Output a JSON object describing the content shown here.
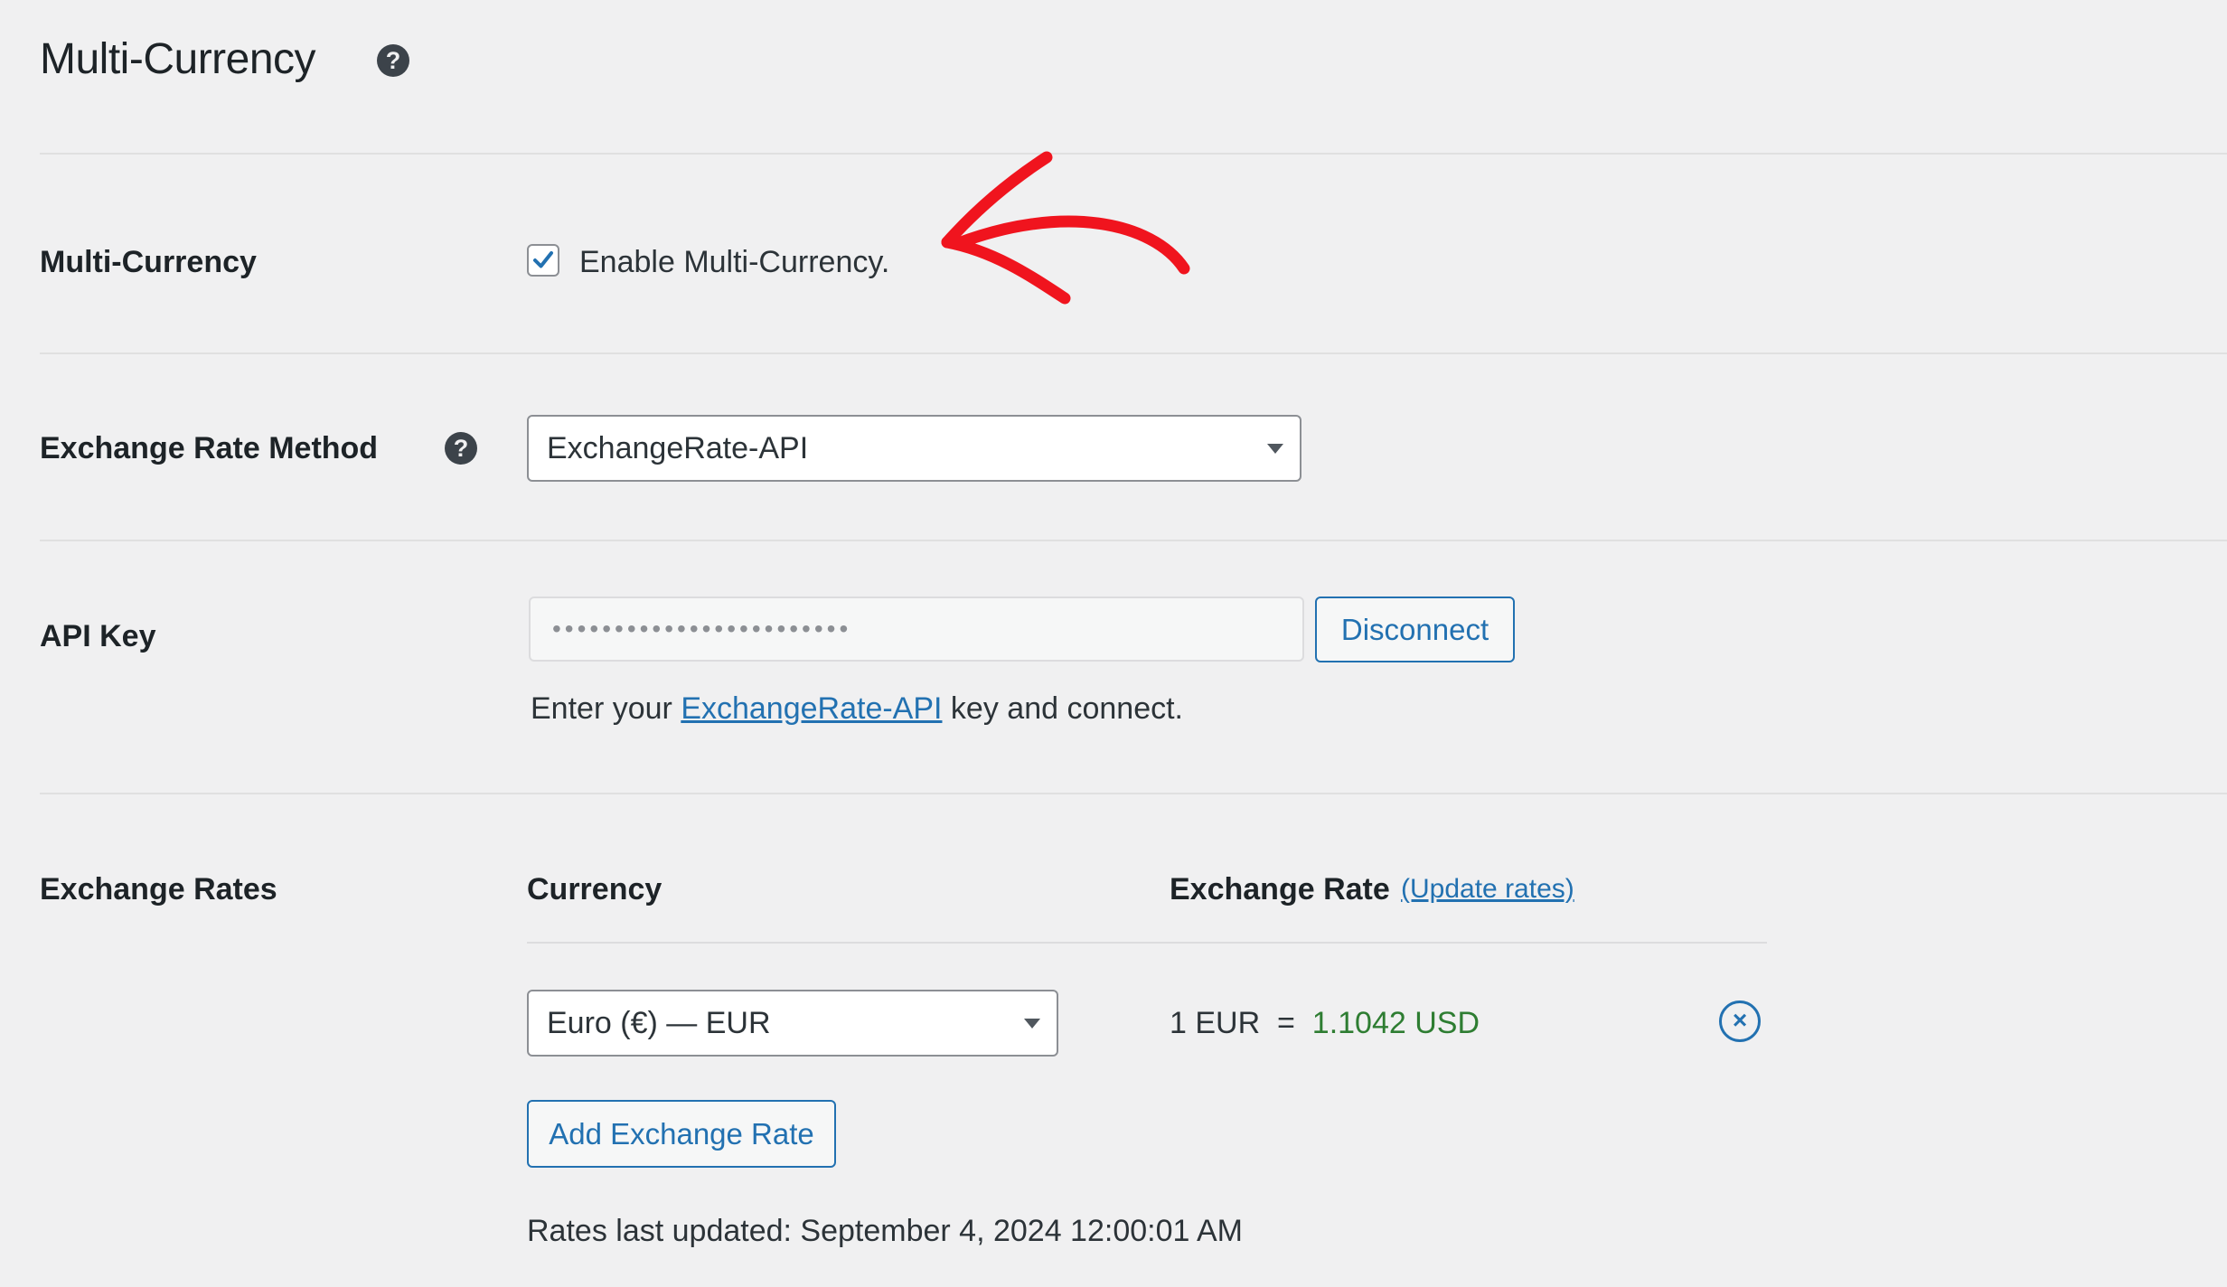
{
  "page": {
    "title": "Multi-Currency"
  },
  "multi_currency": {
    "label": "Multi-Currency",
    "checkbox_label": "Enable Multi-Currency.",
    "checked": true
  },
  "exchange_rate_method": {
    "label": "Exchange Rate Method",
    "selected": "ExchangeRate-API"
  },
  "api_key": {
    "label": "API Key",
    "masked_value": "••••••••••••••••••••••••",
    "disconnect_label": "Disconnect",
    "help_prefix": "Enter your ",
    "help_link": "ExchangeRate-API",
    "help_suffix": " key and connect."
  },
  "exchange_rates": {
    "label": "Exchange Rates",
    "col_currency": "Currency",
    "col_rate": "Exchange Rate",
    "update_link": "(Update rates)",
    "rows": [
      {
        "currency": "Euro (€) — EUR",
        "rate_prefix": "1 EUR  =  ",
        "rate_value": "1.1042",
        "rate_unit": "USD"
      }
    ],
    "add_button": "Add Exchange Rate",
    "last_updated": "Rates last updated: September 4, 2024 12:00:01 AM"
  },
  "icons": {
    "help": "question-circle-icon",
    "remove": "close-circle-icon",
    "checkmark": "check-icon",
    "caret": "caret-down-icon",
    "annotation": "red-arrow-annotation"
  },
  "colors": {
    "accent": "#2271b1",
    "rate_value": "#2e7d32",
    "annotation": "#f0141e",
    "background": "#f0f0f1"
  }
}
